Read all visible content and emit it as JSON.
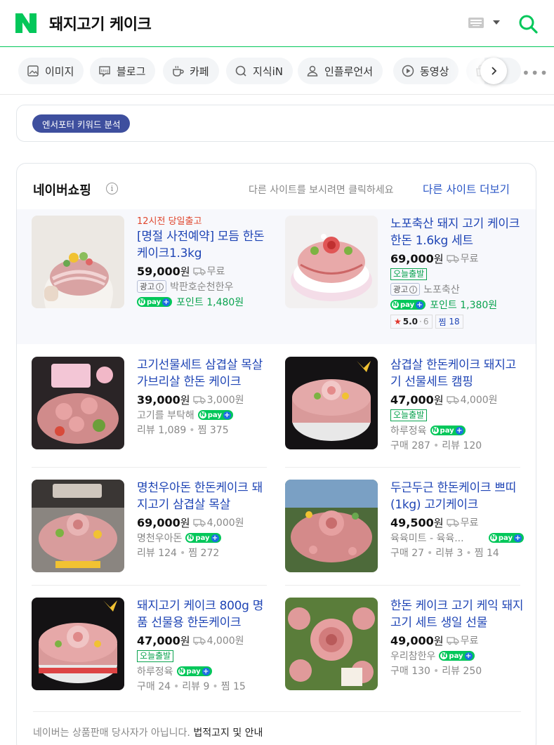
{
  "header": {
    "query": "돼지고기 케이크",
    "logo_letter": "N",
    "brand_color": "#03c75a"
  },
  "tabs": [
    {
      "label": "이미지",
      "icon": "image-icon"
    },
    {
      "label": "블로그",
      "icon": "blog-icon"
    },
    {
      "label": "카페",
      "icon": "cafe-icon"
    },
    {
      "label": "지식iN",
      "icon": "kin-icon"
    },
    {
      "label": "인플루언서",
      "icon": "person-icon"
    },
    {
      "label": "동영상",
      "icon": "play-icon"
    },
    {
      "label": "",
      "icon": "shopping-icon"
    }
  ],
  "keyword_tool": {
    "label": "엔서포터 키워드 분석"
  },
  "shopping": {
    "title": "네이버쇼핑",
    "hint": "다른 사이트를 보시려면 클릭하세요",
    "more_link": "다른 사이트 더보기",
    "products": [
      {
        "promo": "12시전 당일출고",
        "title": "[명절 사전예약] 모듬 한돈 케이크1.3kg",
        "price": "59,000",
        "won": "원",
        "shipping": "무료",
        "ad_label": "광고",
        "seller": "박판호순천한우",
        "point_text": "포인트 1,480원"
      },
      {
        "title": "노포축산 돼지 고기 케이크 한돈 1.6kg 세트",
        "price": "69,000",
        "won": "원",
        "shipping": "무료",
        "today_badge": "오늘출발",
        "ad_label": "광고",
        "seller": "노포축산",
        "point_text": "포인트 1,380원",
        "rating": "5.0",
        "rating_count": "6",
        "jjim_label": "찜",
        "jjim_count": "18"
      },
      {
        "title": "고기선물세트 삼겹살 목살 가브리살 한돈 케이크",
        "price": "39,000",
        "won": "원",
        "shipping": "3,000원",
        "seller": "고기를 부탁해",
        "stats": [
          "리뷰 1,089",
          "찜 375"
        ]
      },
      {
        "title": "삼겹살 한돈케이크 돼지고기 선물세트 캠핑",
        "price": "47,000",
        "won": "원",
        "shipping": "4,000원",
        "today_badge": "오늘출발",
        "seller": "하루정육",
        "stats": [
          "구매 287",
          "리뷰 120"
        ]
      },
      {
        "title": "명천우아돈 한돈케이크 돼지고기 삼겹살 목살",
        "price": "69,000",
        "won": "원",
        "shipping": "4,000원",
        "seller": "명천우아돈",
        "stats": [
          "리뷰 124",
          "찜 272"
        ]
      },
      {
        "title": "두근두근 한돈케이크 쁘띠(1kg) 고기케이크",
        "price": "49,500",
        "won": "원",
        "shipping": "무료",
        "seller": "육육미트 - 육육...",
        "stats": [
          "구매 27",
          "리뷰 3",
          "찜 14"
        ]
      },
      {
        "title": "돼지고기 케이크 800g 명품 선물용 한돈케이크",
        "price": "47,000",
        "won": "원",
        "shipping": "4,000원",
        "today_badge": "오늘출발",
        "seller": "하루정육",
        "stats": [
          "구매 24",
          "리뷰 9",
          "찜 15"
        ]
      },
      {
        "title": "한돈 케이크 고기 케익 돼지고기 세트 생일 선물",
        "price": "49,000",
        "won": "원",
        "shipping": "무료",
        "seller": "우리참한우",
        "stats": [
          "구매 130",
          "리뷰 250"
        ]
      }
    ],
    "footer": {
      "text": "네이버는 상품판매 당사자가 아닙니다.",
      "link": "법적고지 및 안내"
    }
  },
  "npay": {
    "label": "pay",
    "n": "N",
    "plus": "+"
  }
}
